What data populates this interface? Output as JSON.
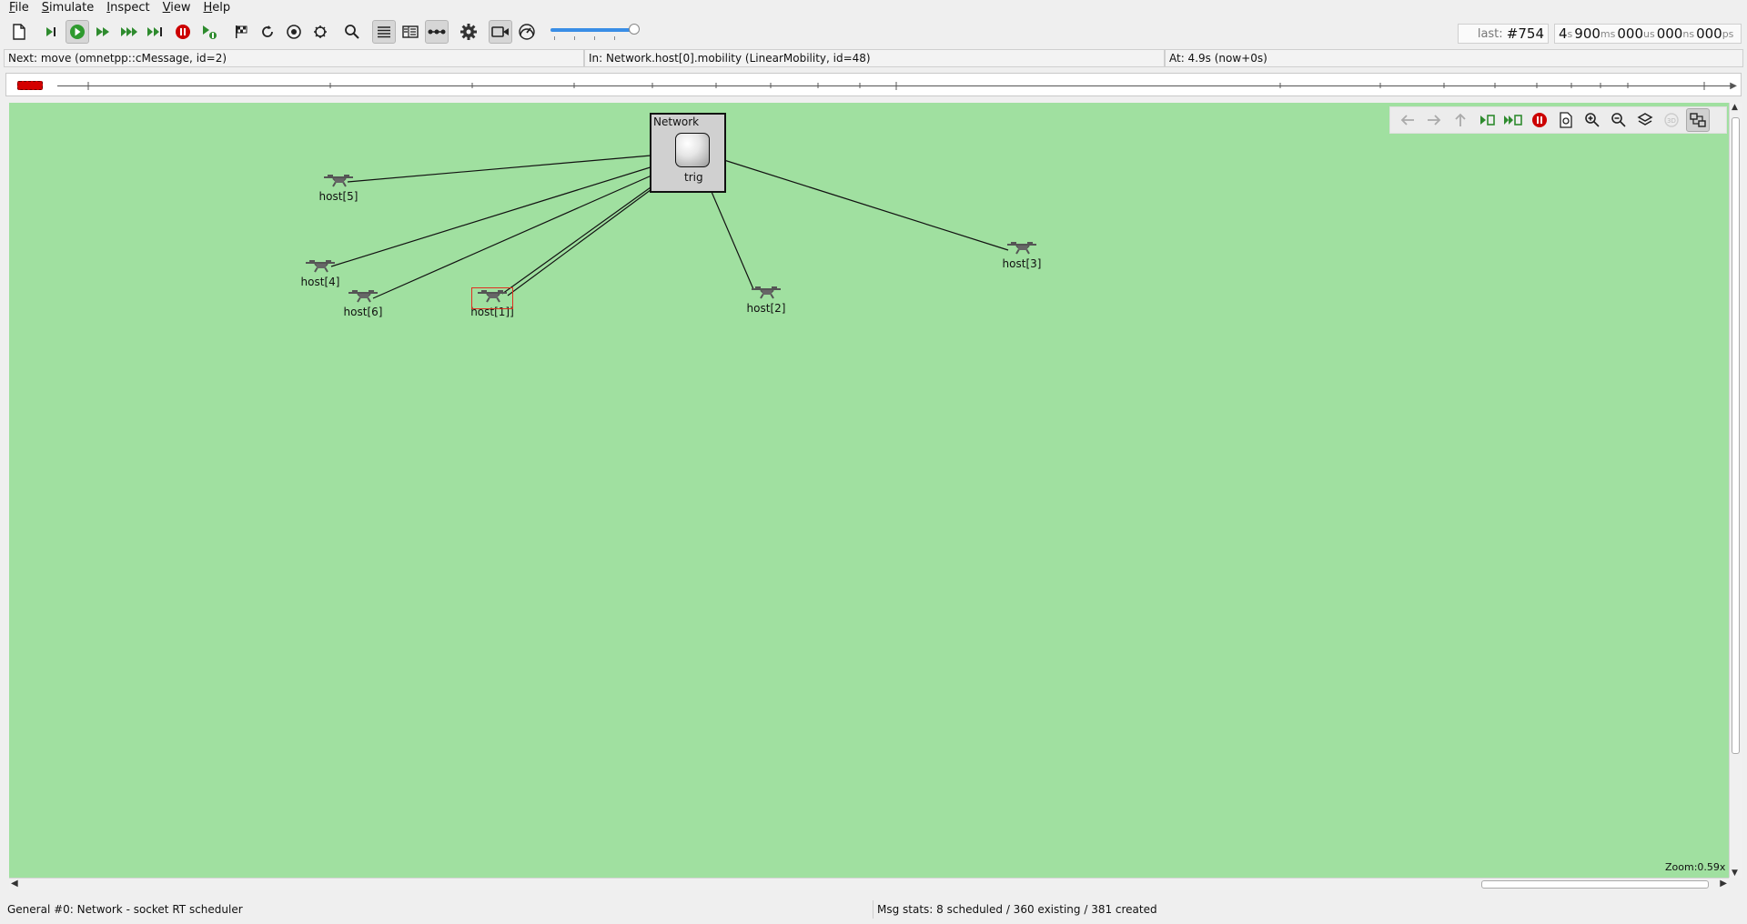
{
  "menu": [
    "File",
    "Simulate",
    "Inspect",
    "View",
    "Help"
  ],
  "toolbar": {
    "buttons": [
      "new-document-icon",
      "step-icon",
      "run-icon",
      "fast-run-icon",
      "express-run-icon",
      "run-until-icon",
      "stop-icon",
      "debug-next-icon",
      "finish-flag-icon",
      "rebuild-icon",
      "record-icon",
      "debug-icon",
      "find-icon",
      "log-view-icon",
      "split-view-icon",
      "connections-icon",
      "settings-icon",
      "camera-icon",
      "speedometer-icon"
    ],
    "speed_slider_value": 0.95
  },
  "event_counter": {
    "prefix": "last: ",
    "value": "#754"
  },
  "sim_time": [
    {
      "value": "4",
      "unit": "s"
    },
    {
      "value": "900",
      "unit": "ms"
    },
    {
      "value": "000",
      "unit": "us"
    },
    {
      "value": "000",
      "unit": "ns"
    },
    {
      "value": "000",
      "unit": "ps"
    }
  ],
  "status": {
    "next": "Next: move (omnetpp::cMessage, id=2)",
    "in": "In: Network.host[0].mobility (LinearMobility, id=48)",
    "at": "At: 4.9s (now+0s)"
  },
  "network": {
    "title": "Network",
    "trig_label": "trig",
    "hosts": [
      "host[5]",
      "host[4]",
      "host[6]",
      "host[1]]",
      "host[2]",
      "host[3]"
    ]
  },
  "canvas_toolbar": [
    "back-icon",
    "forward-icon",
    "up-icon",
    "step-into-icon",
    "fast-into-icon",
    "stop-icon",
    "relayout-icon",
    "zoom-in-icon",
    "zoom-out-icon",
    "layers-icon",
    "3d-icon",
    "fit-icon"
  ],
  "zoom": "Zoom:0.59x",
  "bottom": {
    "left": "General #0: Network - socket RT scheduler",
    "right": "Msg stats: 8 scheduled / 360 existing / 381 created"
  },
  "colors": {
    "canvas": "#a0e0a0",
    "stop": "#cc0000",
    "run": "#2e8b2e"
  }
}
